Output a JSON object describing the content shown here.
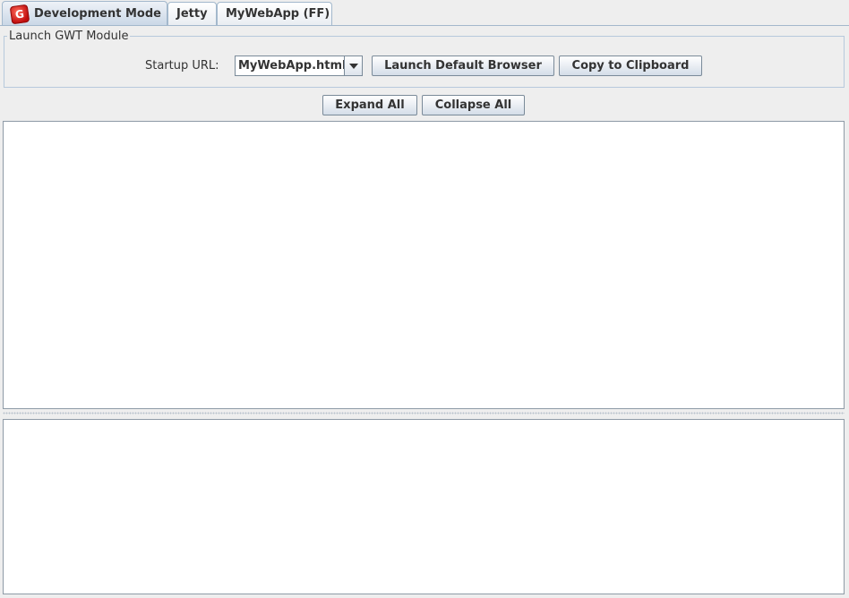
{
  "tabs": [
    {
      "label": "Development Mode",
      "active": true,
      "icon": "gwt-logo-icon"
    },
    {
      "label": "Jetty",
      "active": false
    },
    {
      "label": "MyWebApp (FF)",
      "active": false
    }
  ],
  "launch_group": {
    "title": "Launch GWT Module",
    "startup_label": "Startup URL:",
    "startup_url": "MyWebApp.html",
    "launch_button": "Launch Default Browser",
    "copy_button": "Copy to Clipboard"
  },
  "toolbar": {
    "expand_all": "Expand All",
    "collapse_all": "Collapse All"
  },
  "icon_text": "G",
  "colors": {
    "accent_border": "#a3b8cc",
    "logo_red": "#c10d0d"
  }
}
